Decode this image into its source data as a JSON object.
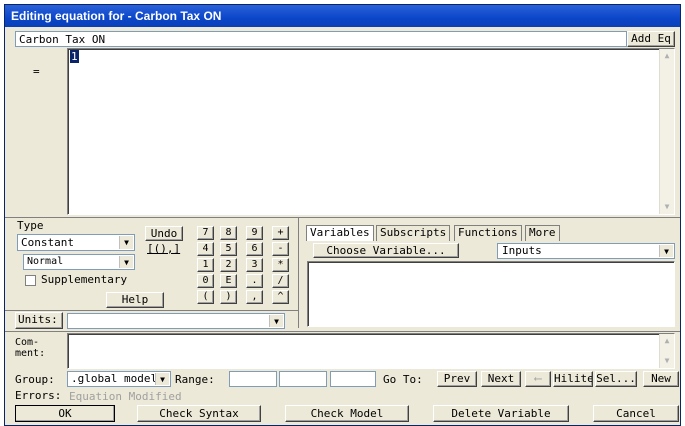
{
  "window": {
    "title": "Editing equation for - Carbon Tax ON"
  },
  "header": {
    "variable_name": "Carbon Tax ON",
    "add_eq_label": "Add Eq"
  },
  "editor": {
    "equals_label": "=",
    "equation_text": "1"
  },
  "type_panel": {
    "title": "Type",
    "type_value": "Constant",
    "subtype_value": "Normal",
    "supplementary_label": "Supplementary",
    "supplementary_checked": false,
    "help_label": "Help"
  },
  "keypad": {
    "undo_label": "Undo",
    "brackets_label": "[(),]",
    "keys": [
      "7",
      "8",
      "9",
      "+",
      "4",
      "5",
      "6",
      "-",
      "1",
      "2",
      "3",
      "*",
      "0",
      "E",
      ".",
      "/",
      "(",
      ")",
      ",",
      "^"
    ]
  },
  "tabs": {
    "items": [
      "Variables",
      "Subscripts",
      "Functions",
      "More"
    ],
    "active": "Variables",
    "choose_variable_label": "Choose Variable...",
    "inputs_value": "Inputs"
  },
  "units": {
    "label": "Units:",
    "value": ""
  },
  "comment": {
    "label_line1": "Com-",
    "label_line2": "ment:",
    "value": ""
  },
  "group_row": {
    "group_label": "Group:",
    "group_value": ".global model",
    "range_label": "Range:",
    "goto_label": "Go To:",
    "prev_label": "Prev",
    "next_label": "Next",
    "back_arrow": "⟵",
    "hilite_label": "Hilite",
    "sel_label": "Sel...",
    "new_label": "New"
  },
  "errors": {
    "label": "Errors:",
    "value": "Equation Modified"
  },
  "footer": {
    "ok_label": "OK",
    "check_syntax_label": "Check Syntax",
    "check_model_label": "Check Model",
    "delete_variable_label": "Delete Variable",
    "cancel_label": "Cancel"
  }
}
